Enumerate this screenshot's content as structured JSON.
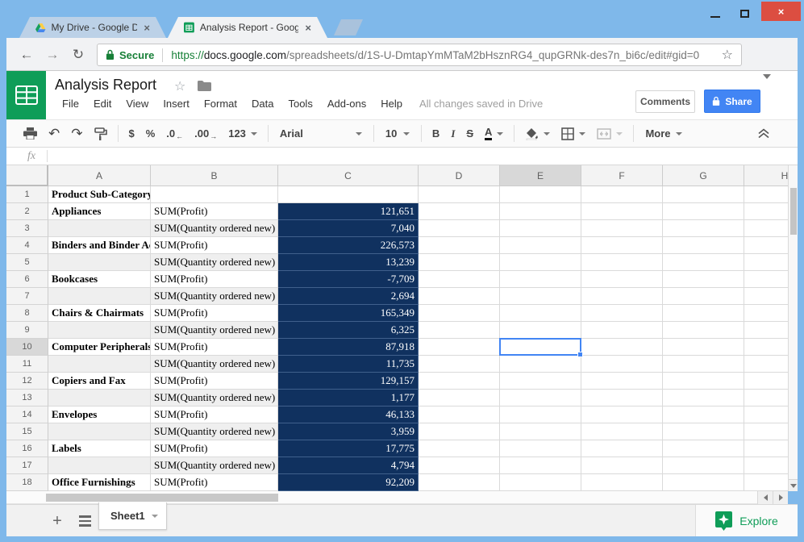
{
  "browser": {
    "tabs": [
      {
        "title": "My Drive - Google Drive",
        "icon": "google-drive-icon"
      },
      {
        "title": "Analysis Report - Google",
        "icon": "google-sheets-icon"
      }
    ],
    "address_bar": {
      "secure_label": "Secure",
      "url_scheme": "https://",
      "url_domain": "docs.google.com",
      "url_path": "/spreadsheets/d/1S-U-DmtapYmMTaM2bHsznRG4_qupGRNk-des7n_bi6c/edit#gid=0"
    }
  },
  "doc_header": {
    "title": "Analysis Report",
    "menu_items": [
      "File",
      "Edit",
      "View",
      "Insert",
      "Format",
      "Data",
      "Tools",
      "Add-ons",
      "Help"
    ],
    "save_status": "All changes saved in Drive",
    "comments_label": "Comments",
    "share_label": "Share"
  },
  "toolbar": {
    "currency": "$",
    "percent": "%",
    "decrease_decimal": ".0",
    "increase_decimal": ".00",
    "number_format": "123",
    "font_name": "Arial",
    "font_size": "10",
    "bold": "B",
    "italic": "I",
    "strikethrough": "S",
    "text_color": "A",
    "more_label": "More"
  },
  "formula_bar": {
    "label": "fx",
    "value": ""
  },
  "sheet": {
    "columns": [
      "A",
      "B",
      "C",
      "D",
      "E",
      "F",
      "G",
      "H"
    ],
    "selected_cell": {
      "column": "E",
      "row": 10
    },
    "rows": [
      {
        "n": 1,
        "A": "Product Sub-Category",
        "B": "",
        "C": ""
      },
      {
        "n": 2,
        "A": "Appliances",
        "B": "SUM(Profit)",
        "C": "121,651"
      },
      {
        "n": 3,
        "A": "",
        "B": "SUM(Quantity ordered new)",
        "C": "7,040"
      },
      {
        "n": 4,
        "A": "Binders and Binder Ac",
        "B": "SUM(Profit)",
        "C": "226,573"
      },
      {
        "n": 5,
        "A": "",
        "B": "SUM(Quantity ordered new)",
        "C": "13,239"
      },
      {
        "n": 6,
        "A": "Bookcases",
        "B": "SUM(Profit)",
        "C": "-7,709"
      },
      {
        "n": 7,
        "A": "",
        "B": "SUM(Quantity ordered new)",
        "C": "2,694"
      },
      {
        "n": 8,
        "A": "Chairs & Chairmats",
        "B": "SUM(Profit)",
        "C": "165,349"
      },
      {
        "n": 9,
        "A": "",
        "B": "SUM(Quantity ordered new)",
        "C": "6,325"
      },
      {
        "n": 10,
        "A": "Computer Peripherals",
        "B": "SUM(Profit)",
        "C": "87,918"
      },
      {
        "n": 11,
        "A": "",
        "B": "SUM(Quantity ordered new)",
        "C": "11,735"
      },
      {
        "n": 12,
        "A": "Copiers and Fax",
        "B": "SUM(Profit)",
        "C": "129,157"
      },
      {
        "n": 13,
        "A": "",
        "B": "SUM(Quantity ordered new)",
        "C": "1,177"
      },
      {
        "n": 14,
        "A": "Envelopes",
        "B": "SUM(Profit)",
        "C": "46,133"
      },
      {
        "n": 15,
        "A": "",
        "B": "SUM(Quantity ordered new)",
        "C": "3,959"
      },
      {
        "n": 16,
        "A": "Labels",
        "B": "SUM(Profit)",
        "C": "17,775"
      },
      {
        "n": 17,
        "A": "",
        "B": "SUM(Quantity ordered new)",
        "C": "4,794"
      },
      {
        "n": 18,
        "A": "Office Furnishings",
        "B": "SUM(Profit)",
        "C": "92,209"
      }
    ]
  },
  "sheet_bar": {
    "sheet_name": "Sheet1",
    "explore_label": "Explore"
  },
  "icons": {
    "google-drive-icon": "tri-color drive triangle",
    "google-sheets-icon": "green square with white table grid",
    "lock-icon": "padlock",
    "star-icon": "☆",
    "folder-icon": "folder",
    "print-icon": "printer",
    "undo-icon": "↶",
    "redo-icon": "↷",
    "paint-format-icon": "paint roller",
    "fill-color-icon": "paint bucket",
    "borders-icon": "grid square",
    "merge-cells-icon": "merge rectangles",
    "explore-icon": "green badge with four-point star",
    "close-icon": "×",
    "kebab-menu-icon": "⋮"
  },
  "colors": {
    "titlebar_blue": "#7FB8EA",
    "close_red": "#DC4E41",
    "secure_green": "#188038",
    "sheets_green": "#0F9D58",
    "share_blue": "#4285F4",
    "navy_cell": "#10315F",
    "selection_blue": "#4285F4",
    "band_grey": "#EFEFEF"
  }
}
